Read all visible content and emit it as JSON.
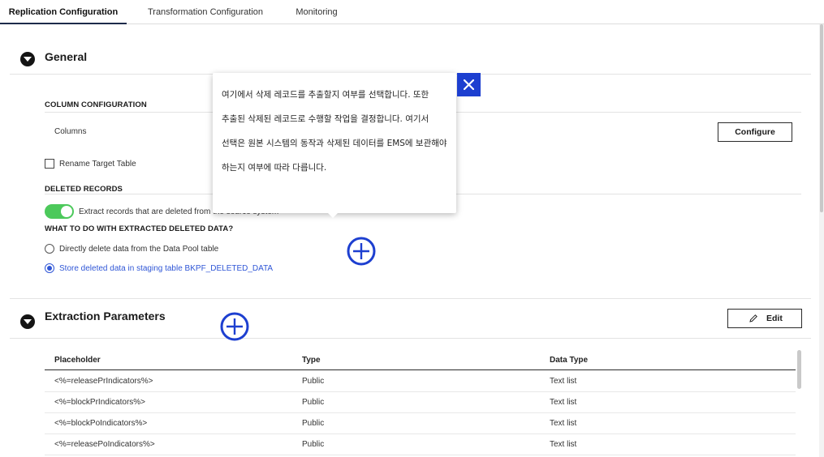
{
  "tabs": [
    {
      "label": "Replication Configuration",
      "active": true
    },
    {
      "label": "Transformation Configuration",
      "active": false
    },
    {
      "label": "Monitoring",
      "active": false
    }
  ],
  "general": {
    "title": "General",
    "column_configuration": {
      "heading": "COLUMN CONFIGURATION",
      "columns_label": "Columns",
      "configure_button": "Configure"
    },
    "rename_target_table": {
      "label": "Rename Target Table",
      "checked": false
    },
    "deleted_records": {
      "heading": "DELETED RECORDS",
      "toggle_label": "Extract records that are deleted from the source system",
      "toggle_on": true
    },
    "what_to_do": {
      "heading": "WHAT TO DO WITH EXTRACTED DELETED DATA?",
      "options": [
        {
          "label": "Directly delete data from the Data Pool table",
          "selected": false
        },
        {
          "label": "Store deleted data in staging table BKPF_DELETED_DATA",
          "selected": true
        }
      ]
    }
  },
  "extraction_parameters": {
    "title": "Extraction Parameters",
    "edit_button": "Edit",
    "columns": [
      "Placeholder",
      "Type",
      "Data Type"
    ],
    "rows": [
      [
        "<%=releasePrIndicators%>",
        "Public",
        "Text list"
      ],
      [
        "<%=blockPrIndicators%>",
        "Public",
        "Text list"
      ],
      [
        "<%=blockPoIndicators%>",
        "Public",
        "Text list"
      ],
      [
        "<%=releasePoIndicators%>",
        "Public",
        "Text list"
      ]
    ]
  },
  "tooltip": {
    "text": "여기에서 삭제 레코드를 추출할지 여부를 선택합니다. 또한 추출된 삭제된 레코드로 수행할 작업을 결정합니다. 여기서 선택은 원본 시스템의 동작과 삭제된 데이터를 EMS에 보관해야 하는지 여부에 따라 다릅니다."
  },
  "colors": {
    "accent_blue": "#1d3fd0",
    "link_blue": "#2f56d6",
    "toggle_green": "#4cc95b",
    "tab_underline": "#1d2b4a"
  },
  "icons": [
    "chevron-down-icon",
    "close-icon",
    "pencil-icon",
    "plus-circle-icon"
  ]
}
